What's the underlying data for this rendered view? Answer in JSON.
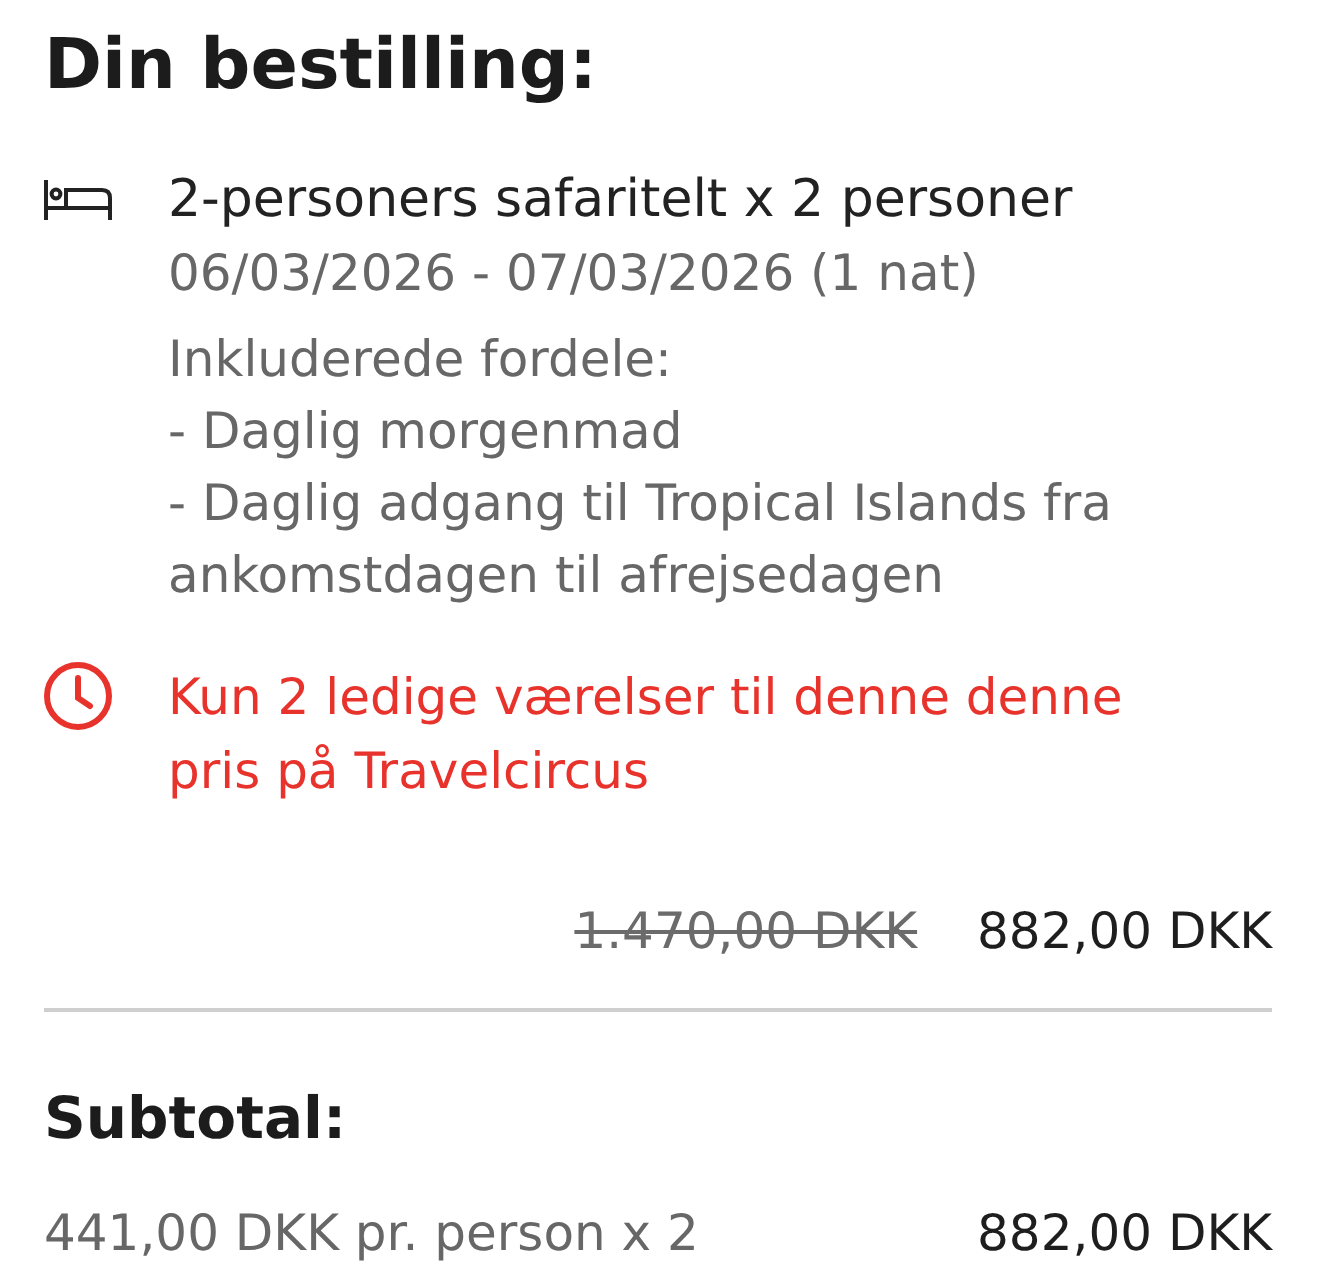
{
  "heading": "Din bestilling:",
  "item": {
    "title": "2-personers safaritelt x 2 personer",
    "dates": "06/03/2026 - 07/03/2026 (1 nat)",
    "benefits_label": "Inkluderede fordele:",
    "benefits": [
      "- Daglig morgenmad",
      "- Daglig adgang til Tropical Islands fra ankomstdagen til afrejsedagen"
    ]
  },
  "alert": {
    "text": "Kun 2 ledige værelser til denne denne pris på Travelcircus"
  },
  "price": {
    "original": "1.470,00 DKK",
    "current": "882,00 DKK"
  },
  "subtotal": {
    "label": "Subtotal:",
    "detail": "441,00 DKK pr. person x 2",
    "amount": "882,00 DKK"
  }
}
